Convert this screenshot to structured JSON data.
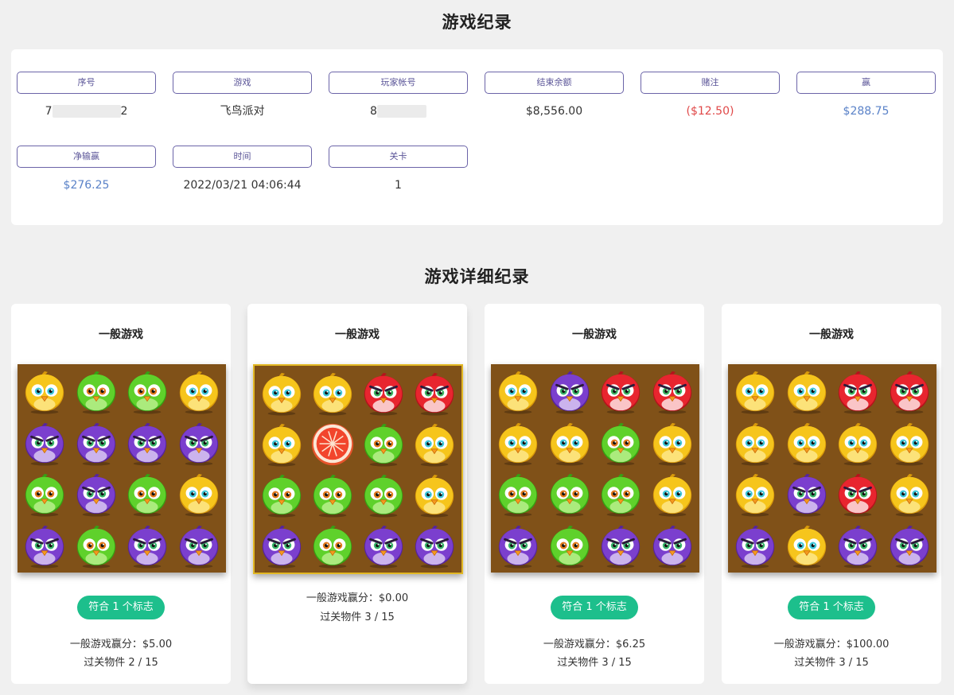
{
  "record": {
    "title": "游戏纪录",
    "fields": [
      {
        "label": "序号",
        "value_start": "7",
        "value_end": "2",
        "tone": "normal"
      },
      {
        "label": "游戏",
        "value": "飞鸟派对",
        "tone": "normal"
      },
      {
        "label": "玩家帐号",
        "value_start": "8",
        "value_end": "",
        "tone": "normal"
      },
      {
        "label": "结束余额",
        "value": "$8,556.00",
        "tone": "normal"
      },
      {
        "label": "赌注",
        "value": "($12.50)",
        "tone": "red"
      },
      {
        "label": "赢",
        "value": "$288.75",
        "tone": "blue"
      },
      {
        "label": "净输赢",
        "value": "$276.25",
        "tone": "blue"
      },
      {
        "label": "时间",
        "value": "2022/03/21 04:06:44",
        "tone": "normal"
      },
      {
        "label": "关卡",
        "value": "1",
        "tone": "normal"
      }
    ]
  },
  "detail": {
    "title": "游戏详细纪录",
    "colors": {
      "badge": "#1dbf8c",
      "board": "#805118",
      "highlight": "#e2b824"
    },
    "cards": [
      {
        "title": "一般游戏",
        "badge": "符合 1 个标志",
        "score": "一般游戏赢分：$5.00",
        "pass": "过关物件 2 / 15",
        "grid": [
          [
            "yellow",
            "green",
            "green",
            "yellow"
          ],
          [
            "purple",
            "purple",
            "purple",
            "purple"
          ],
          [
            "green",
            "purple",
            "green",
            "yellow"
          ],
          [
            "purple",
            "green",
            "purple",
            "purple"
          ]
        ]
      },
      {
        "title": "一般游戏",
        "badge": "",
        "score": "一般游戏赢分：$0.00",
        "pass": "过关物件 3 / 15",
        "grid": [
          [
            "yellow",
            "yellow",
            "red",
            "red"
          ],
          [
            "yellow",
            "grapefruit",
            "green",
            "yellow"
          ],
          [
            "green",
            "green",
            "green",
            "yellow"
          ],
          [
            "purple",
            "green",
            "purple",
            "purple"
          ]
        ]
      },
      {
        "title": "一般游戏",
        "badge": "符合 1 个标志",
        "score": "一般游戏赢分：$6.25",
        "pass": "过关物件 3 / 15",
        "grid": [
          [
            "yellow",
            "purple",
            "red",
            "red"
          ],
          [
            "yellow",
            "yellow",
            "green",
            "yellow"
          ],
          [
            "green",
            "green",
            "green",
            "yellow"
          ],
          [
            "purple",
            "green",
            "purple",
            "purple"
          ]
        ]
      },
      {
        "title": "一般游戏",
        "badge": "符合 1 个标志",
        "score": "一般游戏赢分：$100.00",
        "pass": "过关物件 3 / 15",
        "grid": [
          [
            "yellow",
            "yellow",
            "red",
            "red"
          ],
          [
            "yellow",
            "yellow",
            "yellow",
            "yellow"
          ],
          [
            "yellow",
            "purple",
            "red",
            "yellow"
          ],
          [
            "purple",
            "yellow",
            "purple",
            "purple"
          ]
        ]
      }
    ]
  }
}
